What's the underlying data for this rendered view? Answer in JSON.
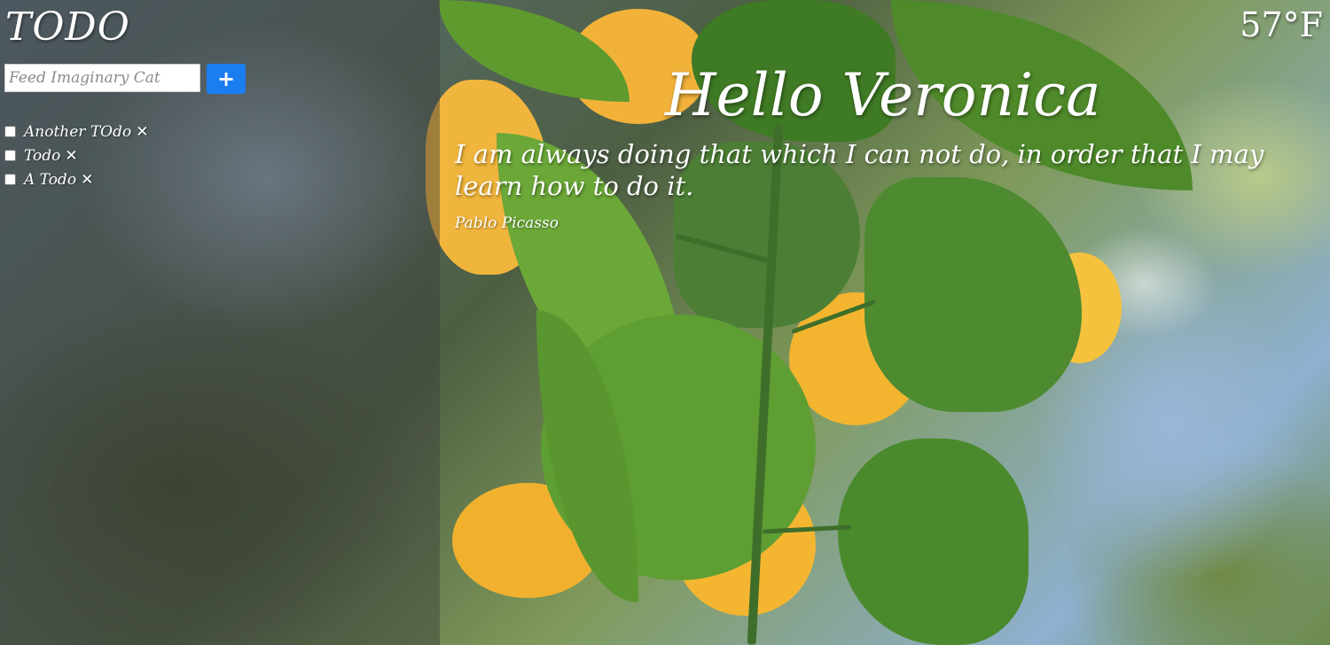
{
  "todo": {
    "title": "TODO",
    "input_placeholder": "Feed Imaginary Cat",
    "input_value": "",
    "add_button_label": "+",
    "items": [
      {
        "label": "Another TOdo",
        "checked": false,
        "delete_icon": "✕"
      },
      {
        "label": "Todo",
        "checked": false,
        "delete_icon": "✕"
      },
      {
        "label": "A Todo",
        "checked": false,
        "delete_icon": "✕"
      }
    ]
  },
  "greeting": "Hello Veronica",
  "quote": {
    "text": "I am always doing that which I can not do, in order that I may learn how to do it.",
    "author": "Pablo Picasso"
  },
  "weather": {
    "temperature": "57°F"
  },
  "colors": {
    "accent": "#1a7df0",
    "text": "#ffffff"
  },
  "icons": {
    "add": "plus-icon",
    "delete": "close-icon"
  }
}
